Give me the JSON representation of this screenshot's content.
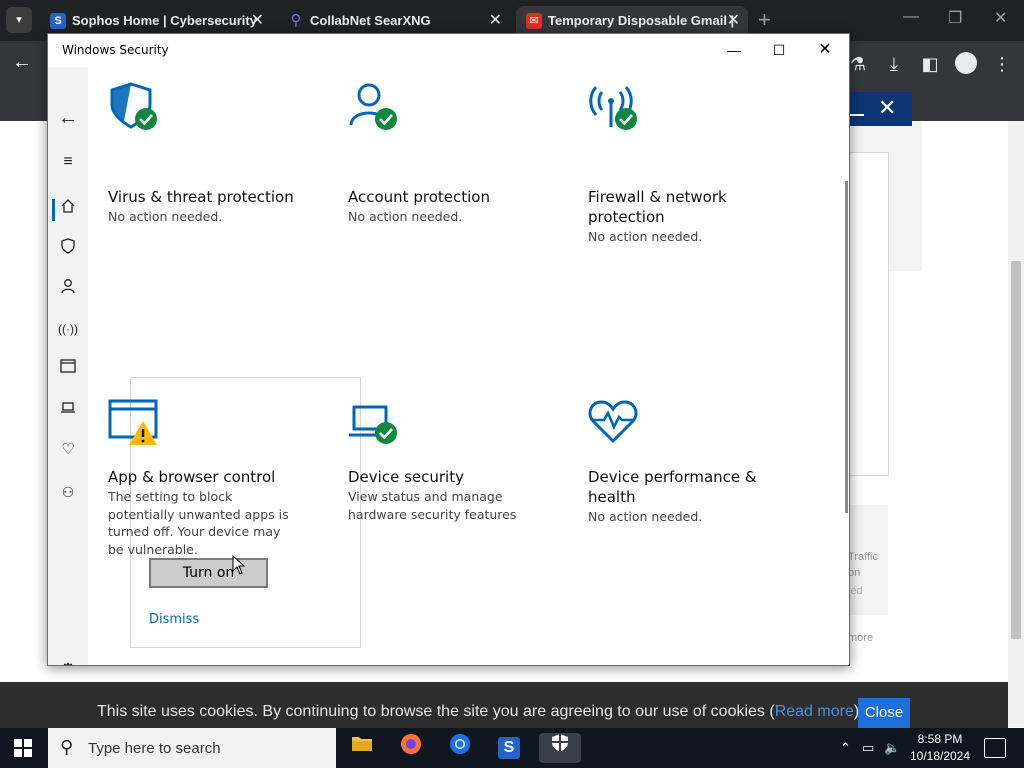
{
  "browser": {
    "tabs": [
      {
        "title": "Sophos Home | Cybersecurity",
        "favicon": "S"
      },
      {
        "title": "CollabNet SearXNG",
        "favicon": "search-icon"
      },
      {
        "title": "Temporary Disposable Gmail |",
        "favicon": "mail-icon"
      }
    ]
  },
  "security": {
    "window_title": "Windows Security",
    "cards": [
      {
        "title": "Virus & threat protection",
        "desc": "No action needed."
      },
      {
        "title": "Account protection",
        "desc": "No action needed."
      },
      {
        "title": "Firewall & network protection",
        "desc": "No action needed."
      },
      {
        "title": "App & browser control",
        "desc": "The setting to block potentially unwanted apps is turned off. Your device may be vulnerable."
      },
      {
        "title": "Device security",
        "desc": "View status and manage hardware security features"
      },
      {
        "title": "Device performance & health",
        "desc": "No action needed."
      }
    ],
    "turn_on_label": "Turn on",
    "dismiss_label": "Dismiss"
  },
  "page": {
    "cookie_text": "This site uses cookies. By continuing to browse the site you are agreeing to our use of cookies (",
    "cookie_link": "Read more",
    "cookie_suffix": ")",
    "cookie_close": "Close",
    "side_text_1": "Traffic",
    "side_text_2": "on",
    "side_text_3": "led",
    "side_text_4": "more"
  },
  "taskbar": {
    "search_placeholder": "Type here to search",
    "time": "8:58 PM",
    "date": "10/18/2024"
  },
  "colors": {
    "accent": "#0067b8",
    "ok_green": "#10893e",
    "warn_yellow": "#ffb900"
  }
}
